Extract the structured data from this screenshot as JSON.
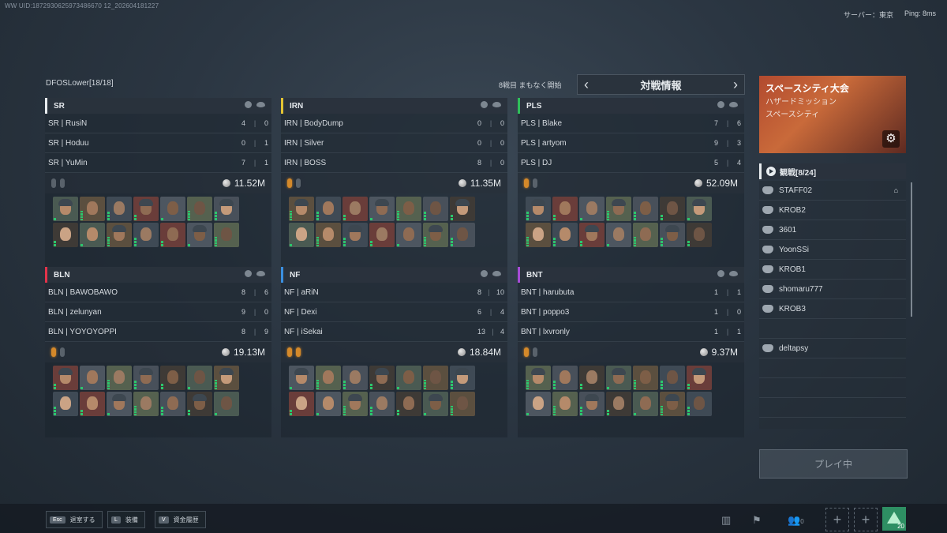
{
  "header": {
    "uid": "WW UID:1872930625973486670 12_202604181227",
    "server_label": "サーバー：東京",
    "ping_label": "Ping: 8ms",
    "lobby_title": "DFOSLower[18/18]",
    "countdown": "8戦目 まもなく開始",
    "info_title": "対戦情報",
    "prev_icon": "chevron-left-icon",
    "next_icon": "chevron-right-icon"
  },
  "teams": [
    {
      "name": "SR",
      "color": "#e8ecef",
      "money": "11.52M",
      "gems": [
        "gray",
        "gray"
      ],
      "players": [
        {
          "name": "SR | RusiN",
          "k": "4",
          "d": "0"
        },
        {
          "name": "SR | Hoduu",
          "k": "0",
          "d": "1"
        },
        {
          "name": "SR | YuMin",
          "k": "7",
          "d": "1"
        }
      ]
    },
    {
      "name": "IRN",
      "color": "#e3c433",
      "money": "11.35M",
      "gems": [
        "orange",
        "gray"
      ],
      "players": [
        {
          "name": "IRN | BodyDump",
          "k": "0",
          "d": "0"
        },
        {
          "name": "IRN | Silver",
          "k": "0",
          "d": "0"
        },
        {
          "name": "IRN | BOSS",
          "k": "8",
          "d": "0"
        }
      ]
    },
    {
      "name": "PLS",
      "color": "#2fbf5a",
      "money": "52.09M",
      "gems": [
        "orange",
        "gray"
      ],
      "players": [
        {
          "name": "PLS | Blake",
          "k": "7",
          "d": "6"
        },
        {
          "name": "PLS | artyom",
          "k": "9",
          "d": "3"
        },
        {
          "name": "PLS | DJ",
          "k": "5",
          "d": "4"
        }
      ]
    },
    {
      "name": "BLN",
      "color": "#e3334a",
      "money": "19.13M",
      "gems": [
        "orange",
        "gray"
      ],
      "players": [
        {
          "name": "BLN | BAWOBAWO",
          "k": "8",
          "d": "6"
        },
        {
          "name": "BLN | zelunyan",
          "k": "9",
          "d": "0"
        },
        {
          "name": "BLN | YOYOYOPPI",
          "k": "8",
          "d": "9"
        }
      ]
    },
    {
      "name": "NF",
      "color": "#3a8fe0",
      "money": "18.84M",
      "gems": [
        "orange",
        "orange"
      ],
      "players": [
        {
          "name": "NF | aRiN",
          "k": "8",
          "d": "10"
        },
        {
          "name": "NF | Dexi",
          "k": "6",
          "d": "4"
        },
        {
          "name": "NF | iSekai",
          "k": "13",
          "d": "4"
        }
      ]
    },
    {
      "name": "BNT",
      "color": "#a64bd6",
      "money": "9.37M",
      "gems": [
        "orange",
        "gray"
      ],
      "players": [
        {
          "name": "BNT | harubuta",
          "k": "1",
          "d": "1"
        },
        {
          "name": "BNT | poppo3",
          "k": "1",
          "d": "0"
        },
        {
          "name": "BNT | lxvronly",
          "k": "1",
          "d": "1"
        }
      ]
    }
  ],
  "event": {
    "title": "スペースシティ大会",
    "subtitle": "ハザードミッション",
    "map": "スペースシティ",
    "settings_icon": "gear-icon"
  },
  "spectators": {
    "label": "観戦[8/24]",
    "list": [
      "STAFF02",
      "KROB2",
      "3601",
      "YoonSSi",
      "KROB1",
      "shomaru777",
      "KROB3",
      "",
      "deltapsy"
    ]
  },
  "play_button": "プレイ中",
  "bottom": {
    "keys": [
      {
        "cap": "Esc",
        "label": "退室する"
      },
      {
        "cap": "L",
        "label": "装備"
      },
      {
        "cap": "V",
        "label": "資金履歴"
      }
    ],
    "party_count": "0",
    "level": "20"
  }
}
